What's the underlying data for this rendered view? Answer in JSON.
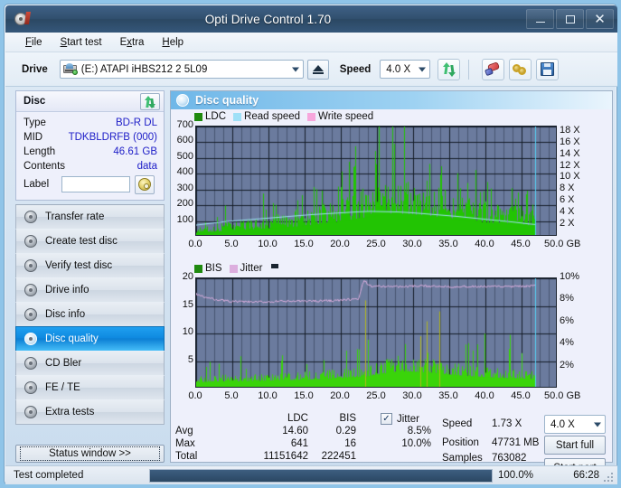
{
  "window": {
    "title": "Opti Drive Control 1.70",
    "app_icon": "disc-icon",
    "minimize": "–",
    "maximize": "□",
    "close": "✕"
  },
  "menubar": {
    "items": [
      {
        "label": "File",
        "accel": "F"
      },
      {
        "label": "Start test",
        "accel": "S"
      },
      {
        "label": "Extra",
        "accel": "x"
      },
      {
        "label": "Help",
        "accel": "H"
      }
    ]
  },
  "toolbar": {
    "drive_label": "Drive",
    "drive_value": "(E:)  ATAPI iHBS212  2 5L09",
    "eject_title": "Eject",
    "speed_label": "Speed",
    "speed_value": "4.0 X",
    "refresh_icon": "refresh-icon",
    "eraser_icon": "eraser-icon",
    "rings_icon": "rings-icon",
    "save_icon": "floppy-save-icon"
  },
  "disc": {
    "header": "Disc",
    "refresh_icon": "refresh-icon",
    "rows": [
      {
        "key": "Type",
        "value": "BD-R DL"
      },
      {
        "key": "MID",
        "value": "TDKBLDRFB (000)"
      },
      {
        "key": "Length",
        "value": "46.61 GB"
      },
      {
        "key": "Contents",
        "value": "data"
      }
    ],
    "label_key": "Label",
    "label_value": "",
    "label_placeholder": "",
    "label_button_icon": "cd-icon"
  },
  "sidebar": {
    "items": [
      {
        "label": "Transfer rate",
        "icon": "disc-transfer-icon",
        "selected": false
      },
      {
        "label": "Create test disc",
        "icon": "disc-create-icon",
        "selected": false
      },
      {
        "label": "Verify test disc",
        "icon": "disc-verify-icon",
        "selected": false
      },
      {
        "label": "Drive info",
        "icon": "disc-drive-icon",
        "selected": false
      },
      {
        "label": "Disc info",
        "icon": "disc-info-icon",
        "selected": false
      },
      {
        "label": "Disc quality",
        "icon": "disc-quality-icon",
        "selected": true
      },
      {
        "label": "CD Bler",
        "icon": "disc-bler-icon",
        "selected": false
      },
      {
        "label": "FE / TE",
        "icon": "disc-fete-icon",
        "selected": false
      },
      {
        "label": "Extra tests",
        "icon": "disc-extra-icon",
        "selected": false
      }
    ],
    "status_window_button": "Status window >>"
  },
  "panel": {
    "title": "Disc quality",
    "icon": "disc-quality-icon"
  },
  "chart_data": [
    {
      "type": "bar",
      "name": "top-chart",
      "title": "",
      "legend": [
        {
          "label": "LDC",
          "color": "#1f8a0f"
        },
        {
          "label": "Read speed",
          "color": "#8fd8f4"
        },
        {
          "label": "Write speed",
          "color": "#f58fd0"
        }
      ],
      "legend_position": "top-left",
      "xlabel": "GB",
      "ylabel": "",
      "xlim": [
        0,
        50
      ],
      "xticks": [
        0.0,
        5.0,
        10.0,
        15.0,
        20.0,
        25.0,
        30.0,
        35.0,
        40.0,
        45.0,
        50.0
      ],
      "xticklabels": [
        "0.0",
        "5.0",
        "10.0",
        "15.0",
        "20.0",
        "25.0",
        "30.0",
        "35.0",
        "40.0",
        "45.0",
        "50.0 GB"
      ],
      "ylim": [
        0,
        700
      ],
      "yticks": [
        100,
        200,
        300,
        400,
        500,
        600,
        700
      ],
      "yticklabels": [
        "100",
        "200",
        "300",
        "400",
        "500",
        "600",
        "700"
      ],
      "y2lim": [
        0,
        18.9
      ],
      "y2ticks": [
        2,
        4,
        6,
        8,
        10,
        12,
        14,
        16,
        18
      ],
      "y2ticklabels": [
        "2 X",
        "4 X",
        "6 X",
        "8 X",
        "10 X",
        "12 X",
        "14 X",
        "16 X",
        "18 X"
      ],
      "grid": true,
      "series": [
        {
          "name": "LDC",
          "color": "#22c403",
          "kind": "spiky-bars",
          "description": "Dense green LDC error spikes across disc; baseline rises from ~40 near 0 GB, climbs steadily, peaks around 24-32 GB with spikes up to ~650, tapers toward 47 GB.",
          "baseline_profile": [
            40,
            55,
            70,
            80,
            95,
            105,
            120,
            140,
            165,
            195,
            225,
            250,
            265,
            255,
            235,
            210,
            185,
            165,
            150,
            140,
            130
          ],
          "max_spike": 650,
          "data_end_gb": 46.9
        },
        {
          "name": "Read speed",
          "color": "#9fe0f7",
          "kind": "line",
          "description": "Smooth read-speed CAV curve rising from ~2X at 0 GB to ~4.3X near 24 GB, then declining to ~2.1X at 47 GB.",
          "points_x": [
            0,
            2,
            4,
            6,
            8,
            10,
            12,
            14,
            16,
            18,
            20,
            22,
            24,
            26,
            28,
            30,
            32,
            34,
            36,
            38,
            40,
            42,
            44,
            46,
            47
          ],
          "points_y2": [
            2.0,
            2.3,
            2.6,
            2.8,
            3.0,
            3.2,
            3.4,
            3.6,
            3.8,
            3.95,
            4.1,
            4.25,
            4.35,
            4.3,
            4.25,
            4.1,
            3.9,
            3.7,
            3.5,
            3.25,
            3.0,
            2.75,
            2.5,
            2.2,
            2.1
          ]
        },
        {
          "name": "Write speed",
          "color": "#f7a6dc",
          "kind": "line",
          "description": "Not present in captured data.",
          "points_x": [],
          "points_y2": []
        },
        {
          "name": "end-marker",
          "color": "#56d2f5",
          "kind": "vline",
          "x": 46.9
        }
      ]
    },
    {
      "type": "bar",
      "name": "bottom-chart",
      "title": "",
      "legend": [
        {
          "label": "BIS",
          "color": "#1f8a0f"
        },
        {
          "label": "Jitter",
          "color": "#d9b3dd"
        }
      ],
      "legend_position": "top-left",
      "xlabel": "GB",
      "ylabel": "",
      "xlim": [
        0,
        50
      ],
      "xticks": [
        0.0,
        5.0,
        10.0,
        15.0,
        20.0,
        25.0,
        30.0,
        35.0,
        40.0,
        45.0,
        50.0
      ],
      "xticklabels": [
        "0.0",
        "5.0",
        "10.0",
        "15.0",
        "20.0",
        "25.0",
        "30.0",
        "35.0",
        "40.0",
        "45.0",
        "50.0 GB"
      ],
      "ylim": [
        0,
        20
      ],
      "yticks": [
        5,
        10,
        15,
        20
      ],
      "yticklabels": [
        "5",
        "10",
        "15",
        "20"
      ],
      "y2lim": [
        0,
        10
      ],
      "y2ticks": [
        2,
        4,
        6,
        8,
        10
      ],
      "y2ticklabels": [
        "2%",
        "4%",
        "6%",
        "8%",
        "10%"
      ],
      "grid": true,
      "series": [
        {
          "name": "BIS",
          "color": "#3ad40a",
          "kind": "spiky-bars",
          "description": "Green BIS spikes, low (mostly under 5) up to ~23 GB, heavier between 23-35 GB with peaks up to ~14, then moderate to 47 GB.",
          "baseline_profile": [
            1.4,
            1.5,
            1.6,
            1.6,
            1.7,
            1.8,
            1.9,
            2.0,
            2.2,
            2.4,
            2.6,
            3.2,
            3.8,
            3.6,
            3.4,
            3.0,
            2.7,
            2.5,
            2.3,
            2.2,
            2.0
          ],
          "max_spike": 14,
          "data_end_gb": 46.9
        },
        {
          "name": "Jitter",
          "color": "#dcaede",
          "kind": "line",
          "description": "Jitter trace near 8.5% (≈17 left-scale) falling to ~7.8% until 23 GB, then stepping up to ~9.3% and holding flat to 47 GB.",
          "points_x": [
            0,
            1,
            3,
            5,
            8,
            12,
            16,
            20,
            22.5,
            23.2,
            24,
            28,
            32,
            36,
            40,
            44,
            47
          ],
          "points_y": [
            17.2,
            16.6,
            16.1,
            15.8,
            15.7,
            15.8,
            15.9,
            16.0,
            16.3,
            19.7,
            18.6,
            18.5,
            18.6,
            18.5,
            18.5,
            18.5,
            18.6
          ]
        },
        {
          "name": "end-marker",
          "color": "#56d2f5",
          "kind": "vline",
          "x": 46.9
        }
      ]
    }
  ],
  "stats": {
    "col_headers": [
      "LDC",
      "BIS"
    ],
    "row_labels": [
      "Avg",
      "Max",
      "Total"
    ],
    "ldc": {
      "avg": "14.60",
      "max": "641",
      "total": "11151642"
    },
    "bis": {
      "avg": "0.29",
      "max": "16",
      "total": "222451"
    },
    "jitter": {
      "checkbox_label": "Jitter",
      "checked": true,
      "avg": "8.5%",
      "max": "10.0%"
    },
    "speed_label": "Speed",
    "speed_value": "1.73 X",
    "position_label": "Position",
    "position_value": "47731 MB",
    "samples_label": "Samples",
    "samples_value": "763082",
    "speed_select": "4.0 X",
    "start_full": "Start full",
    "start_part": "Start part"
  },
  "statusbar": {
    "message": "Test completed",
    "progress_percent": 100,
    "progress_label": "100.0%",
    "elapsed": "66:28"
  },
  "colors": {
    "title_bar": "#31506f",
    "accent_blue": "#0f8ae0",
    "value_blue": "#2020c8",
    "plot_bg": "#6b7b9e",
    "ldc_green": "#22c403",
    "bis_green": "#3ad40a",
    "jitter_pink": "#dcaede",
    "read_speed_cyan": "#9fe0f7",
    "write_speed_pink": "#f7a6dc",
    "panel_bg": "#eef0fb"
  }
}
